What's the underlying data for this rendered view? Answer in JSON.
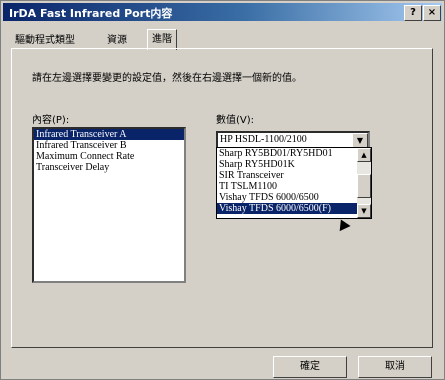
{
  "window": {
    "title": "IrDA Fast Infrared Port内容",
    "help_label": "?",
    "close_label": "×"
  },
  "tabs": [
    {
      "label": "驅動程式類型"
    },
    {
      "label": "資源"
    },
    {
      "label": "進階"
    }
  ],
  "instruction": "請在左邊選擇要變更的設定值，然後在右邊選擇一個新的值。",
  "property_label": "內容(P):",
  "properties": [
    "Infrared Transceiver A",
    "Infrared Transceiver B",
    "Maximum Connect Rate",
    "Transceiver Delay"
  ],
  "selected_property": "Infrared Transceiver A",
  "value_label": "數值(V):",
  "value_current": "HP HSDL-1100/2100",
  "value_options": [
    "Sharp RY5BD01/RY5HD01",
    "Sharp RY5HD01K",
    "SIR Transceiver",
    "TI TSLM1100",
    "Vishay TFDS 6000/6500",
    "Vishay TFDS 6000/6500(F)"
  ],
  "selected_value": "Vishay TFDS 6000/6500(F)",
  "buttons": {
    "ok": "確定",
    "cancel": "取消"
  }
}
